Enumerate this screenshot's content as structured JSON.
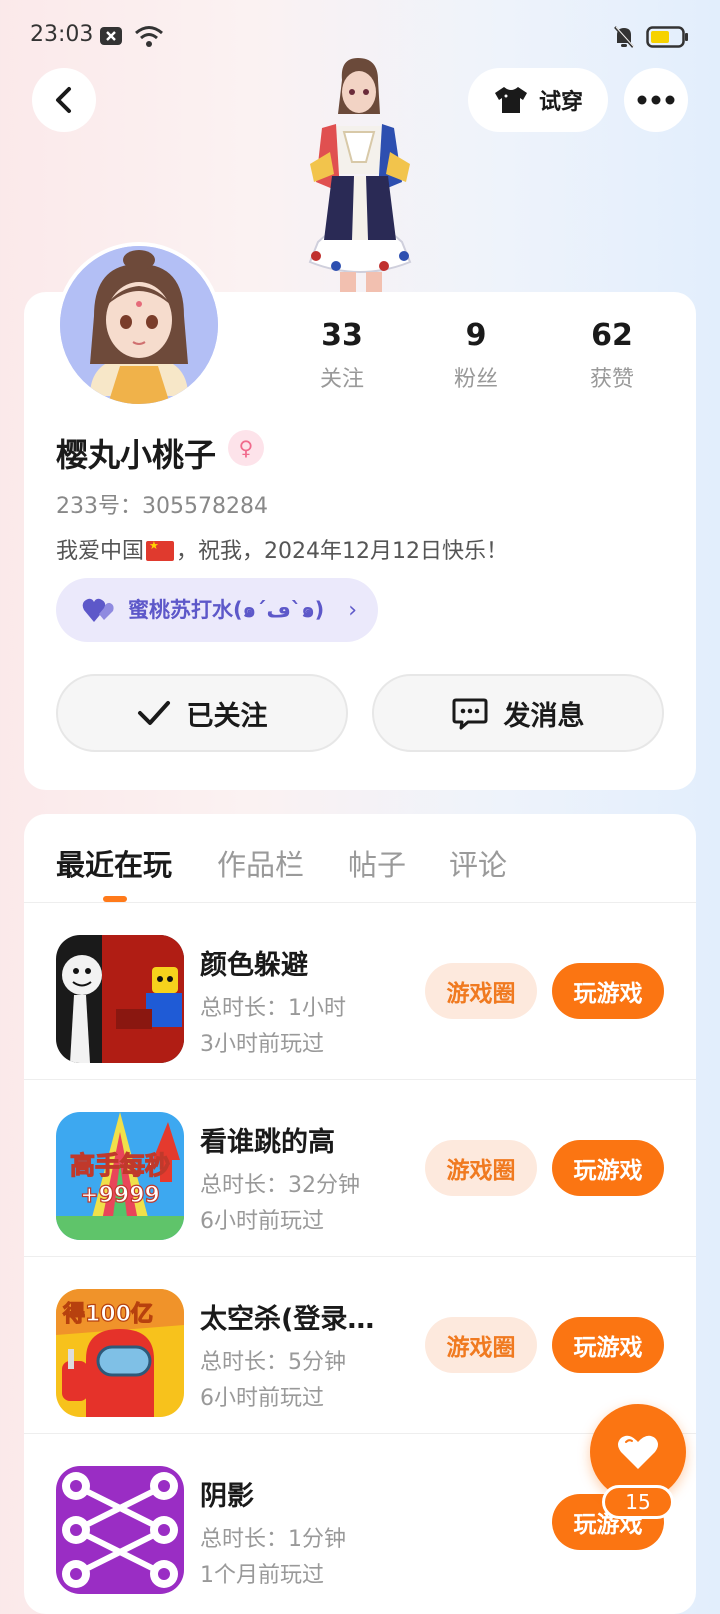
{
  "status_bar": {
    "time": "23:03"
  },
  "header": {
    "tryon_label": "试穿"
  },
  "profile": {
    "stats": [
      {
        "value": "33",
        "label": "关注"
      },
      {
        "value": "9",
        "label": "粉丝"
      },
      {
        "value": "62",
        "label": "获赞"
      }
    ],
    "name": "樱丸小桃子",
    "id_label": "233号：",
    "id_value": "305578284",
    "bio_prefix": "我爱中国",
    "bio_suffix": "，祝我，2024年12月12日快乐！",
    "club_name": "蜜桃苏打水(๑´ڡ`๑)",
    "follow_label": "已关注",
    "message_label": "发消息"
  },
  "tabs": [
    "最近在玩",
    "作品栏",
    "帖子",
    "评论"
  ],
  "games": [
    {
      "title": "颜色躲避",
      "duration": "总时长：1小时",
      "last_played": "3小时前玩过",
      "circle_label": "游戏圈",
      "play_label": "玩游戏"
    },
    {
      "title": "看谁跳的高",
      "duration": "总时长：32分钟",
      "last_played": "6小时前玩过",
      "circle_label": "游戏圈",
      "play_label": "玩游戏",
      "icon_text_1": "高手每秒",
      "icon_text_2": "+9999"
    },
    {
      "title": "太空杀(登录送...",
      "duration": "总时长：5分钟",
      "last_played": "6小时前玩过",
      "circle_label": "游戏圈",
      "play_label": "玩游戏",
      "icon_text": "得100亿"
    },
    {
      "title": "阴影",
      "duration": "总时长：1分钟",
      "last_played": "1个月前玩过",
      "play_label": "玩游戏"
    }
  ],
  "like_fab": {
    "count": "15"
  },
  "colors": {
    "accent": "#fb7512",
    "accent_light": "#fde9dd",
    "club": "#5d58c9"
  }
}
